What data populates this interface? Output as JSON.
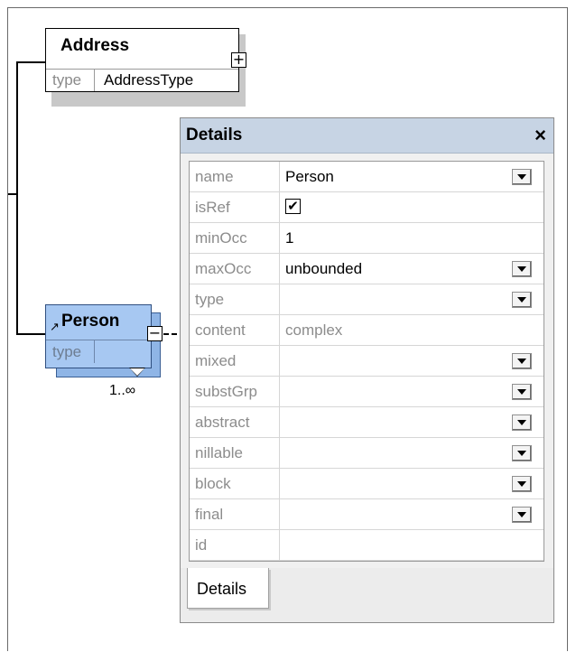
{
  "diagram": {
    "address": {
      "name": "Address",
      "type_label": "type",
      "type_value": "AddressType",
      "expander": "+"
    },
    "person": {
      "name": "Person",
      "type_label": "type",
      "occurrence": "1..∞",
      "expander": "−",
      "ref_marker": "↗"
    }
  },
  "details_panel": {
    "title": "Details",
    "close_glyph": "×",
    "properties": [
      {
        "name": "name",
        "value": "Person",
        "dropdown": true,
        "style": "normal"
      },
      {
        "name": "isRef",
        "value": "✔",
        "checkbox": true
      },
      {
        "name": "minOcc",
        "value": "1",
        "dropdown": false,
        "style": "normal"
      },
      {
        "name": "maxOcc",
        "value": "unbounded",
        "dropdown": true,
        "style": "normal"
      },
      {
        "name": "type",
        "value": "",
        "dropdown": true
      },
      {
        "name": "content",
        "value": "complex",
        "dropdown": false,
        "style": "grey"
      },
      {
        "name": "mixed",
        "value": "",
        "dropdown": true
      },
      {
        "name": "substGrp",
        "value": "",
        "dropdown": true
      },
      {
        "name": "abstract",
        "value": "",
        "dropdown": true
      },
      {
        "name": "nillable",
        "value": "",
        "dropdown": true
      },
      {
        "name": "block",
        "value": "",
        "dropdown": true
      },
      {
        "name": "final",
        "value": "",
        "dropdown": true
      },
      {
        "name": "id",
        "value": "",
        "dropdown": false
      }
    ],
    "tab_label": "Details"
  }
}
